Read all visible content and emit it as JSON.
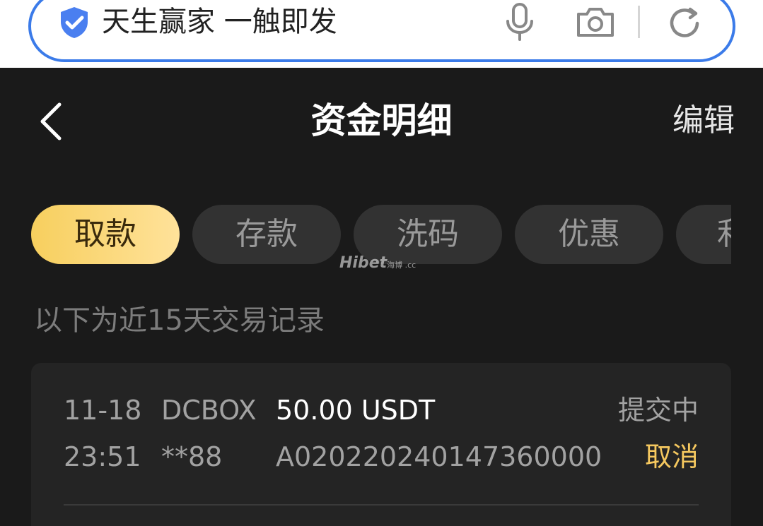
{
  "browser": {
    "search_text": "天生赢家 一触即发",
    "accent_color": "#3b7be9",
    "icons": [
      "shield-check-icon",
      "microphone-icon",
      "camera-icon",
      "refresh-icon"
    ]
  },
  "header": {
    "title": "资金明细",
    "edit_label": "编辑",
    "back_icon": "chevron-left-icon"
  },
  "tabs": [
    {
      "label": "取款",
      "active": true
    },
    {
      "label": "存款",
      "active": false
    },
    {
      "label": "洗码",
      "active": false
    },
    {
      "label": "优惠",
      "active": false
    },
    {
      "label": "利",
      "active": false
    }
  ],
  "watermark": {
    "brand": "Hibet",
    "sub": "海博 .cc"
  },
  "records_notice": "以下为近15天交易记录",
  "records": [
    {
      "date": "11-18",
      "time": "23:51",
      "channel": "DCBOX",
      "account": "**88",
      "amount": "50.00 USDT",
      "order_id": "A02022024014736​0000",
      "status": "提交中",
      "action_label": "取消"
    }
  ],
  "colors": {
    "background": "#1a1a1a",
    "card": "#242424",
    "active_tab_start": "#f7cf5e",
    "active_tab_end": "#ffe29a",
    "cancel_text": "#f5c85f"
  }
}
